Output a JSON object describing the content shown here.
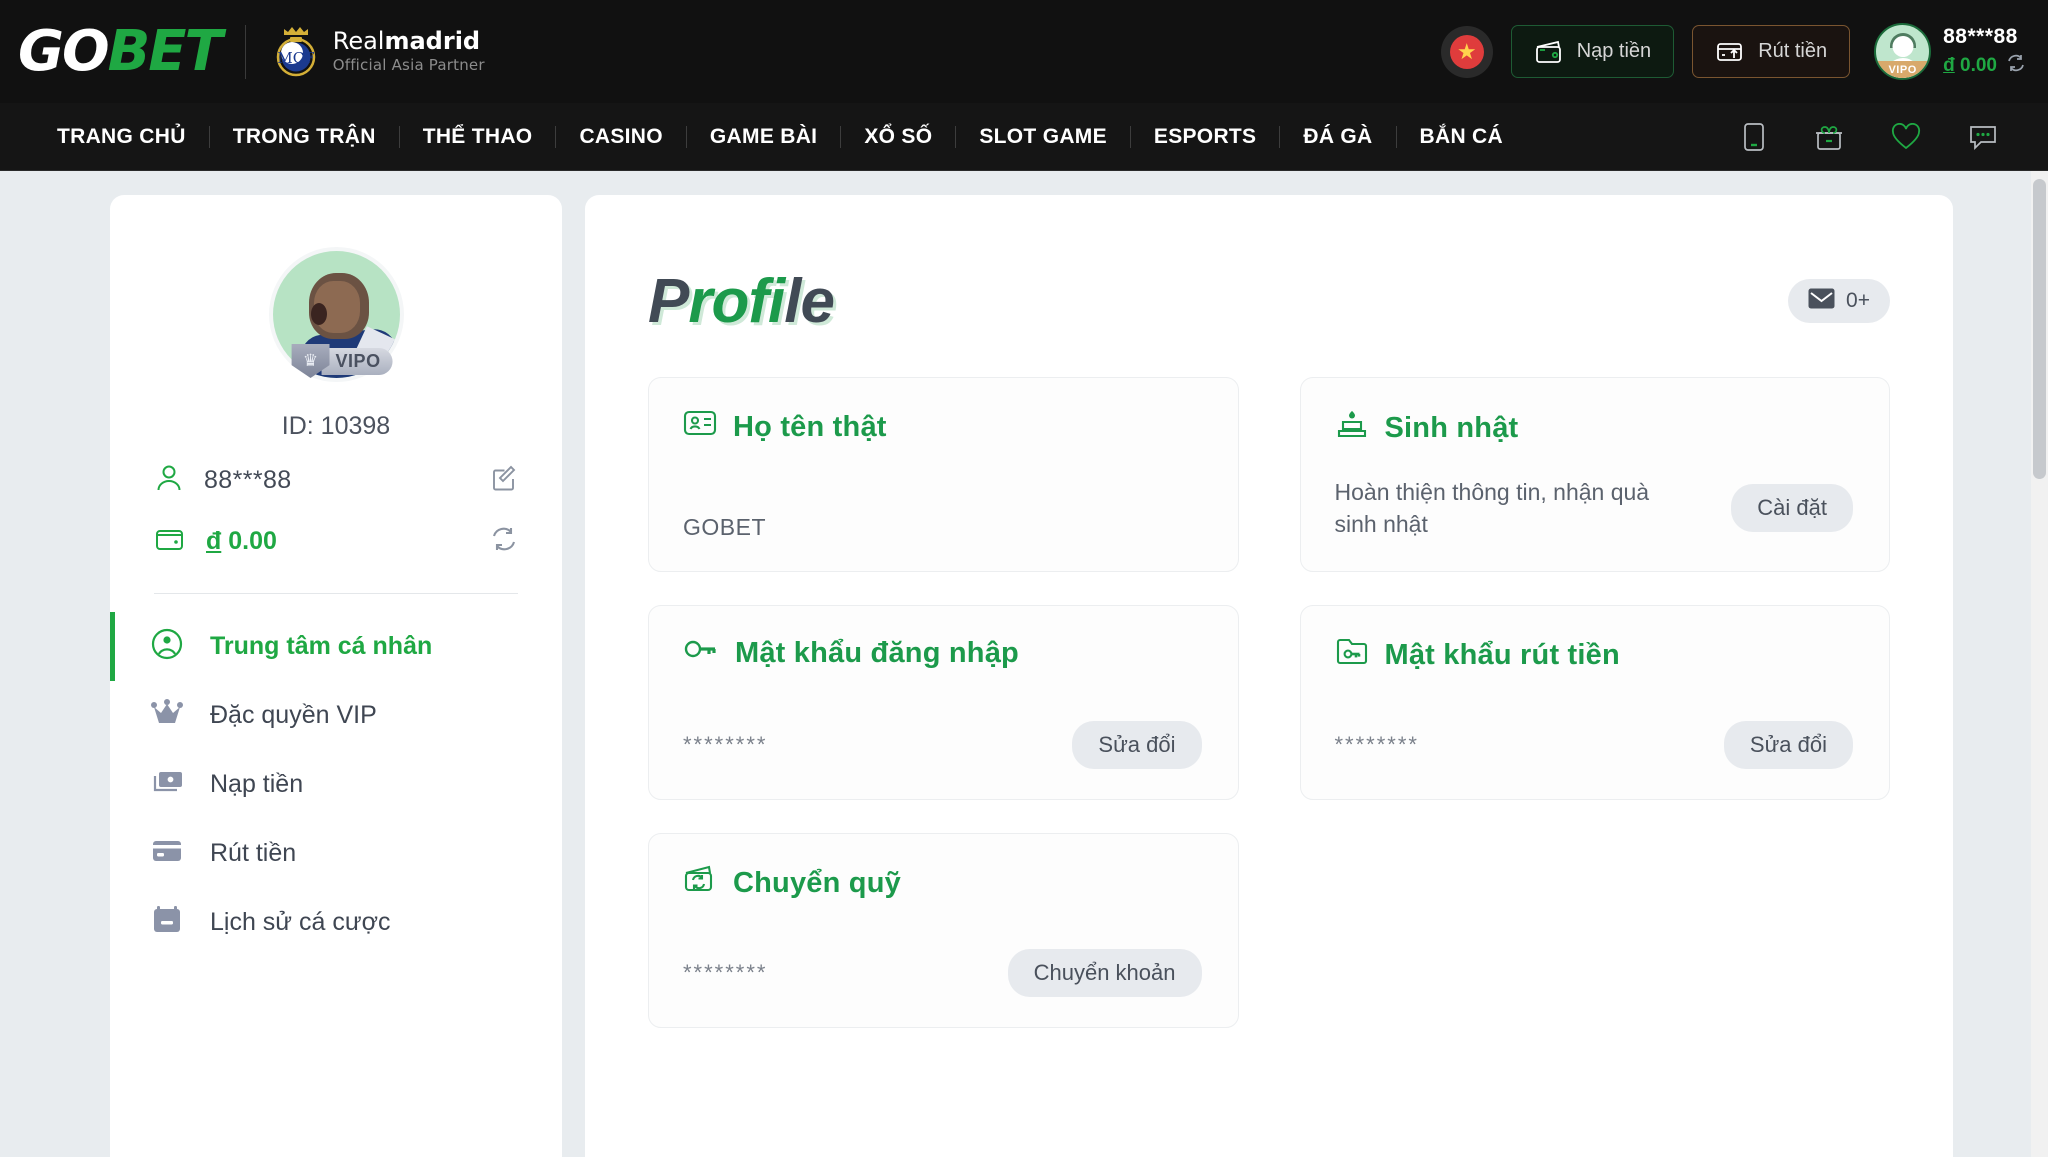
{
  "brand": {
    "logo_go": "GO",
    "logo_bet": "BET",
    "partner_line1_light": "Real",
    "partner_line1_bold": "madrid",
    "partner_line2": "Official Asia Partner"
  },
  "header": {
    "flag_icon": "vietnam-flag-icon",
    "deposit_label": "Nạp tiền",
    "withdraw_label": "Rút tiền",
    "account_name": "88***88",
    "currency_symbol": "đ",
    "balance": "0.00",
    "vip_badge": "VIPO",
    "refresh_icon": "refresh-icon"
  },
  "nav": {
    "items": [
      {
        "label": "TRANG CHỦ"
      },
      {
        "label": "TRONG TRẬN"
      },
      {
        "label": "THỂ THAO"
      },
      {
        "label": "CASINO"
      },
      {
        "label": "GAME BÀI"
      },
      {
        "label": "XỔ SỐ"
      },
      {
        "label": "SLOT GAME"
      },
      {
        "label": "ESPORTS"
      },
      {
        "label": "ĐÁ GÀ"
      },
      {
        "label": "BẮN CÁ"
      }
    ],
    "icons": [
      "mobile-app-icon",
      "gift-icon",
      "heart-icon",
      "chat-icon"
    ]
  },
  "sidebar": {
    "vip_badge": "VIPO",
    "id_label": "ID: 10398",
    "username": "88***88",
    "edit_icon": "edit-icon",
    "currency_symbol": "đ",
    "balance": "0.00",
    "refresh_icon": "refresh-icon",
    "items": [
      {
        "label": "Trung tâm cá nhân",
        "icon": "user-circle-icon",
        "active": true
      },
      {
        "label": "Đặc quyền VIP",
        "icon": "crown-icon",
        "active": false
      },
      {
        "label": "Nạp tiền",
        "icon": "cash-icon",
        "active": false
      },
      {
        "label": "Rút tiền",
        "icon": "card-icon",
        "active": false
      },
      {
        "label": "Lịch sử cá cược",
        "icon": "calendar-icon",
        "active": false
      }
    ]
  },
  "main": {
    "title_part1": "P",
    "title_part2": "rofi",
    "title_part3": "le",
    "mail_icon": "envelope-icon",
    "mail_count": "0+",
    "cards": [
      {
        "title": "Họ tên thật",
        "icon": "id-card-icon",
        "value": "GOBET",
        "desc": "",
        "button": ""
      },
      {
        "title": "Sinh nhật",
        "icon": "cake-icon",
        "value": "",
        "desc": "Hoàn thiện thông tin, nhận quà sinh nhật",
        "button": "Cài đặt"
      },
      {
        "title": "Mật khẩu đăng nhập",
        "icon": "key-icon",
        "value": "********",
        "desc": "",
        "button": "Sửa đổi"
      },
      {
        "title": "Mật khẩu rút tiền",
        "icon": "folder-key-icon",
        "value": "********",
        "desc": "",
        "button": "Sửa đổi"
      },
      {
        "title": "Chuyển quỹ",
        "icon": "wallet-transfer-icon",
        "value": "********",
        "desc": "",
        "button": "Chuyển khoản"
      }
    ]
  },
  "colors": {
    "brand_green": "#1fa843",
    "dark_header": "#111111",
    "page_bg": "#e8ecef",
    "slate": "#414a55"
  }
}
